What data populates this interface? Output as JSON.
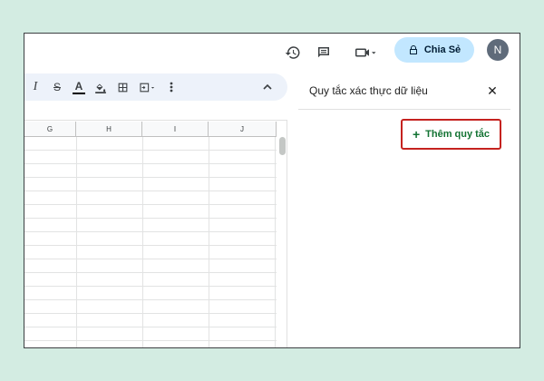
{
  "topbar": {
    "icons": [
      "history-icon",
      "comment-icon",
      "video-call-icon"
    ],
    "share_label": "Chia Sẻ",
    "avatar_initial": "N"
  },
  "toolbar": {
    "tools": [
      "I",
      "S",
      "A"
    ],
    "collapse_icon": "chevron-up-icon"
  },
  "sheet": {
    "columns": [
      "G",
      "H",
      "I",
      "J"
    ]
  },
  "panel": {
    "title": "Quy tắc xác thực dữ liệu",
    "add_rule_label": "Thêm quy tắc",
    "add_rule_icon": "+"
  },
  "colors": {
    "background": "#d3ece2",
    "share_button": "#c2e7ff",
    "highlight_border": "#c5221f",
    "accent_green": "#137333"
  }
}
